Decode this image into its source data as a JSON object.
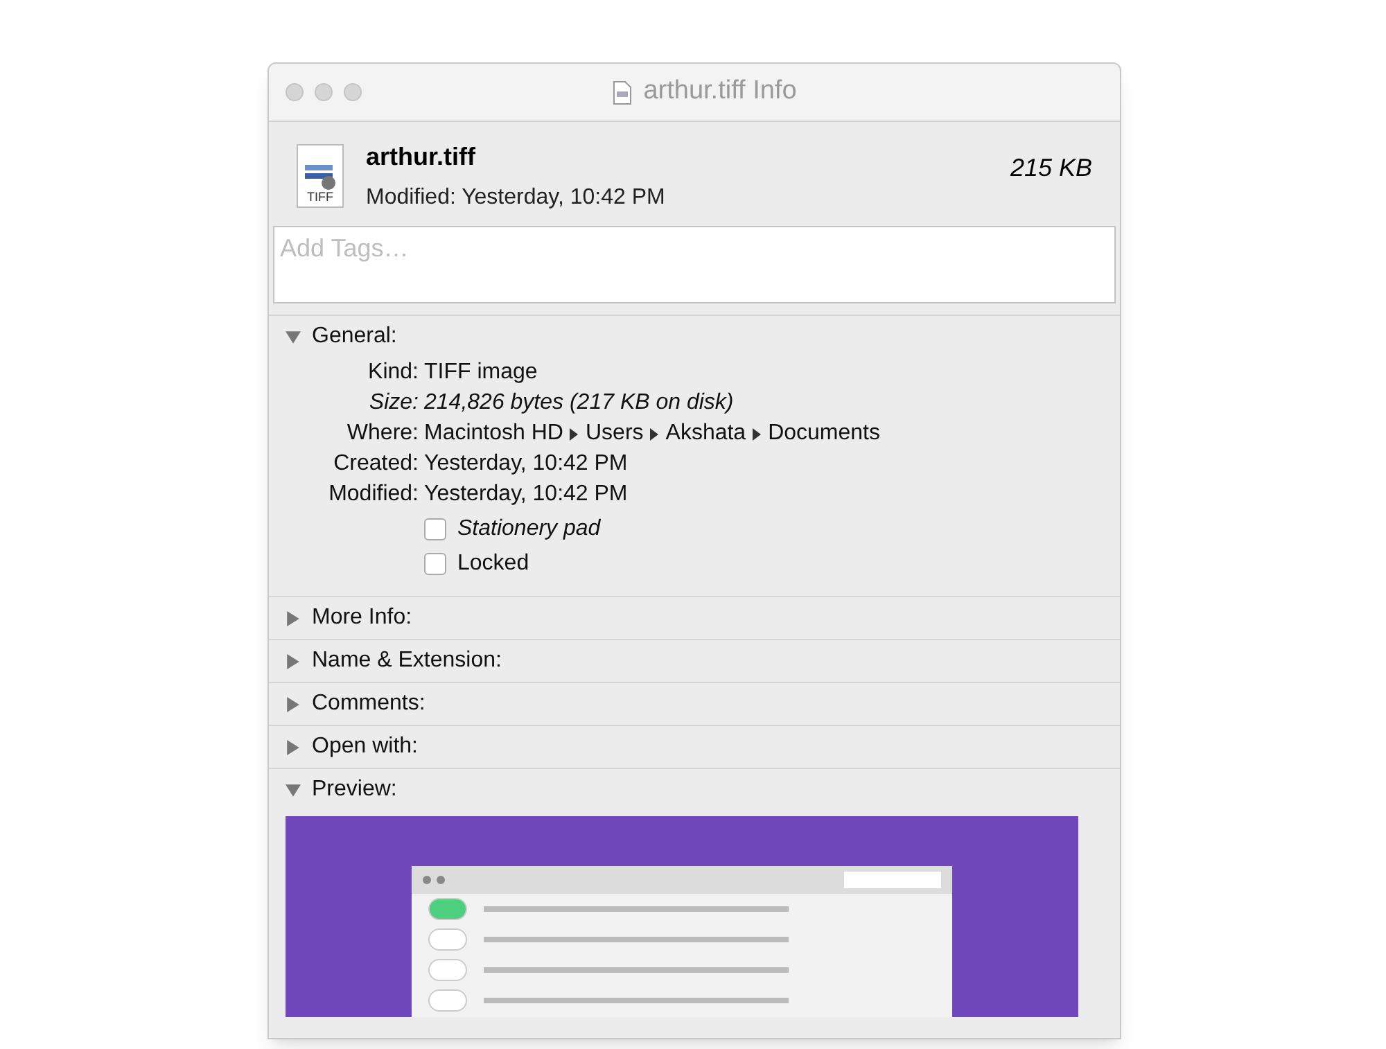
{
  "window": {
    "title": "arthur.tiff Info"
  },
  "header": {
    "file_name": "arthur.tiff",
    "modified": "Modified: Yesterday, 10:42 PM",
    "size": "215 KB",
    "icon_label": "TIFF"
  },
  "tags": {
    "placeholder": "Add Tags…"
  },
  "sections": [
    {
      "title": "General:",
      "expanded": true,
      "kind": "general",
      "fields": [
        {
          "label": "Kind:",
          "value": "TIFF image"
        },
        {
          "label": "Size:",
          "value": "214,826 bytes (217 KB on disk)",
          "italic": true
        },
        {
          "label": "Where:",
          "path": [
            "Macintosh HD",
            "Users",
            "Akshata",
            "Documents"
          ]
        },
        {
          "label": "Created:",
          "value": "Yesterday, 10:42 PM"
        },
        {
          "label": "Modified:",
          "value": "Yesterday, 10:42 PM"
        }
      ],
      "checkboxes": [
        {
          "label": "Stationery pad",
          "checked": false,
          "italic": true
        },
        {
          "label": "Locked",
          "checked": false
        }
      ]
    },
    {
      "title": "More Info:",
      "expanded": false
    },
    {
      "title": "Name & Extension:",
      "expanded": false
    },
    {
      "title": "Comments:",
      "expanded": false
    },
    {
      "title": "Open with:",
      "expanded": false
    },
    {
      "title": "Preview:",
      "expanded": true,
      "kind": "preview"
    }
  ]
}
